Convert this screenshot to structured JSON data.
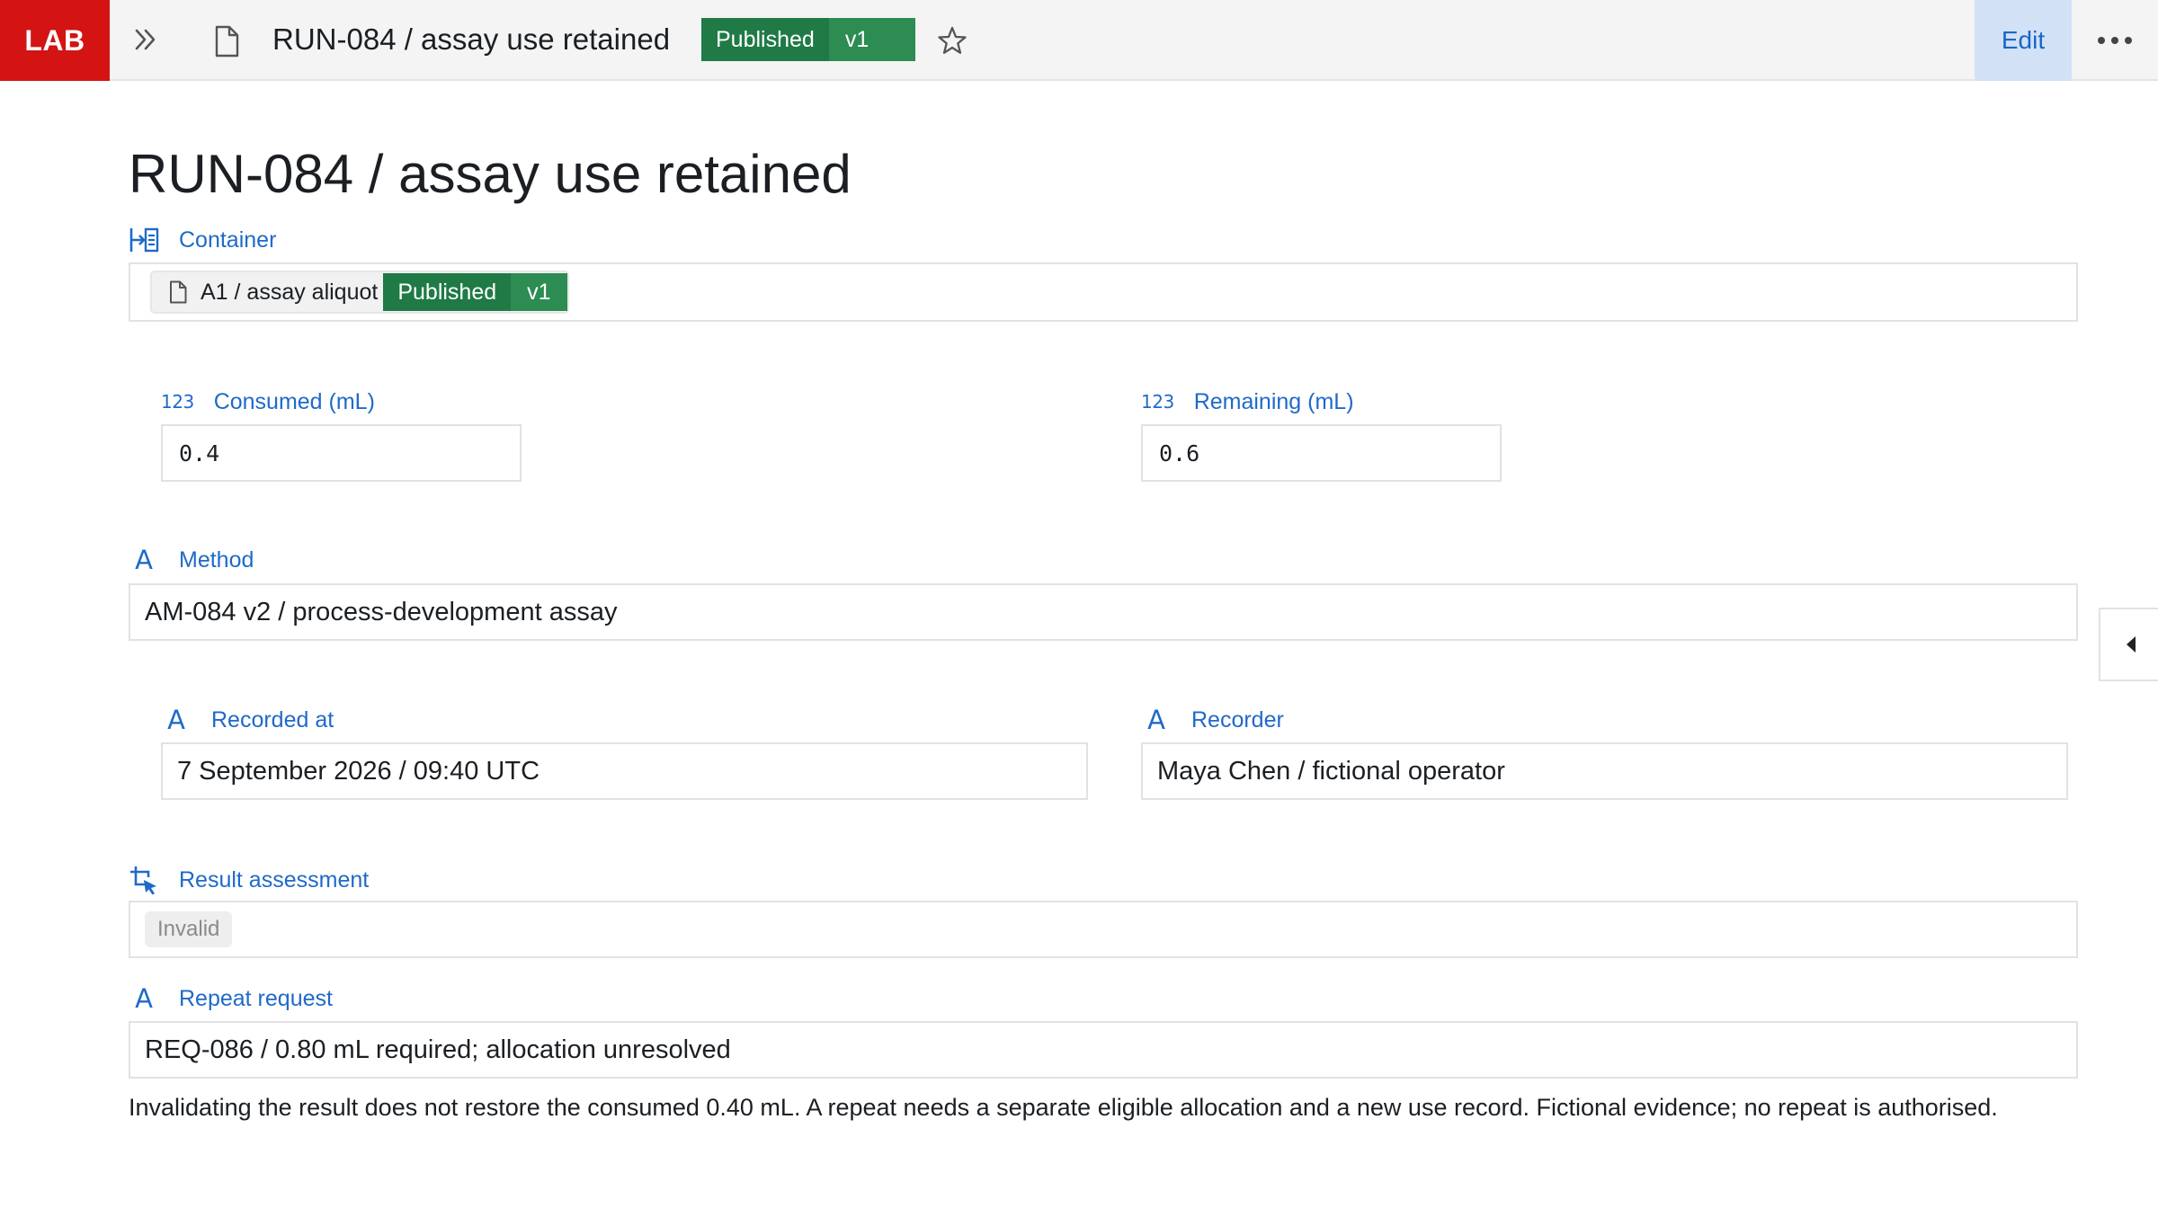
{
  "app": {
    "logo": "LAB"
  },
  "header": {
    "title": "RUN-084 / assay use retained",
    "status": "Published",
    "version": "v1",
    "edit_label": "Edit"
  },
  "page": {
    "title": "RUN-084 / assay use retained"
  },
  "fields": {
    "container": {
      "label": "Container",
      "item": {
        "name": "A1 / assay aliquot",
        "status": "Published",
        "version": "v1"
      }
    },
    "consumed": {
      "label": "Consumed (mL)",
      "value": "0.4",
      "type_glyph": "123"
    },
    "remaining": {
      "label": "Remaining (mL)",
      "value": "0.6",
      "type_glyph": "123"
    },
    "method": {
      "label": "Method",
      "value": "AM-084 v2 / process-development assay"
    },
    "recorded_at": {
      "label": "Recorded at",
      "value": "7 September 2026 / 09:40 UTC"
    },
    "recorder": {
      "label": "Recorder",
      "value": "Maya Chen / fictional operator"
    },
    "result_assessment": {
      "label": "Result assessment",
      "value": "Invalid"
    },
    "repeat_request": {
      "label": "Repeat request",
      "value": "REQ-086 / 0.80 mL required; allocation unresolved"
    }
  },
  "note": "Invalidating the result does not restore the consumed 0.40 mL. A repeat needs a separate eligible allocation and a new use record. Fictional evidence; no repeat is authorised.",
  "icons": {
    "text_field": "A",
    "number_field": "123",
    "relation_field": "list-in-icon",
    "selection_field": "crop-cursor-icon"
  },
  "colors": {
    "logo_bg": "#d41313",
    "published_green": "#1f7a46",
    "label_blue": "#1f6ac8",
    "edit_bg": "#d2e1f5"
  }
}
